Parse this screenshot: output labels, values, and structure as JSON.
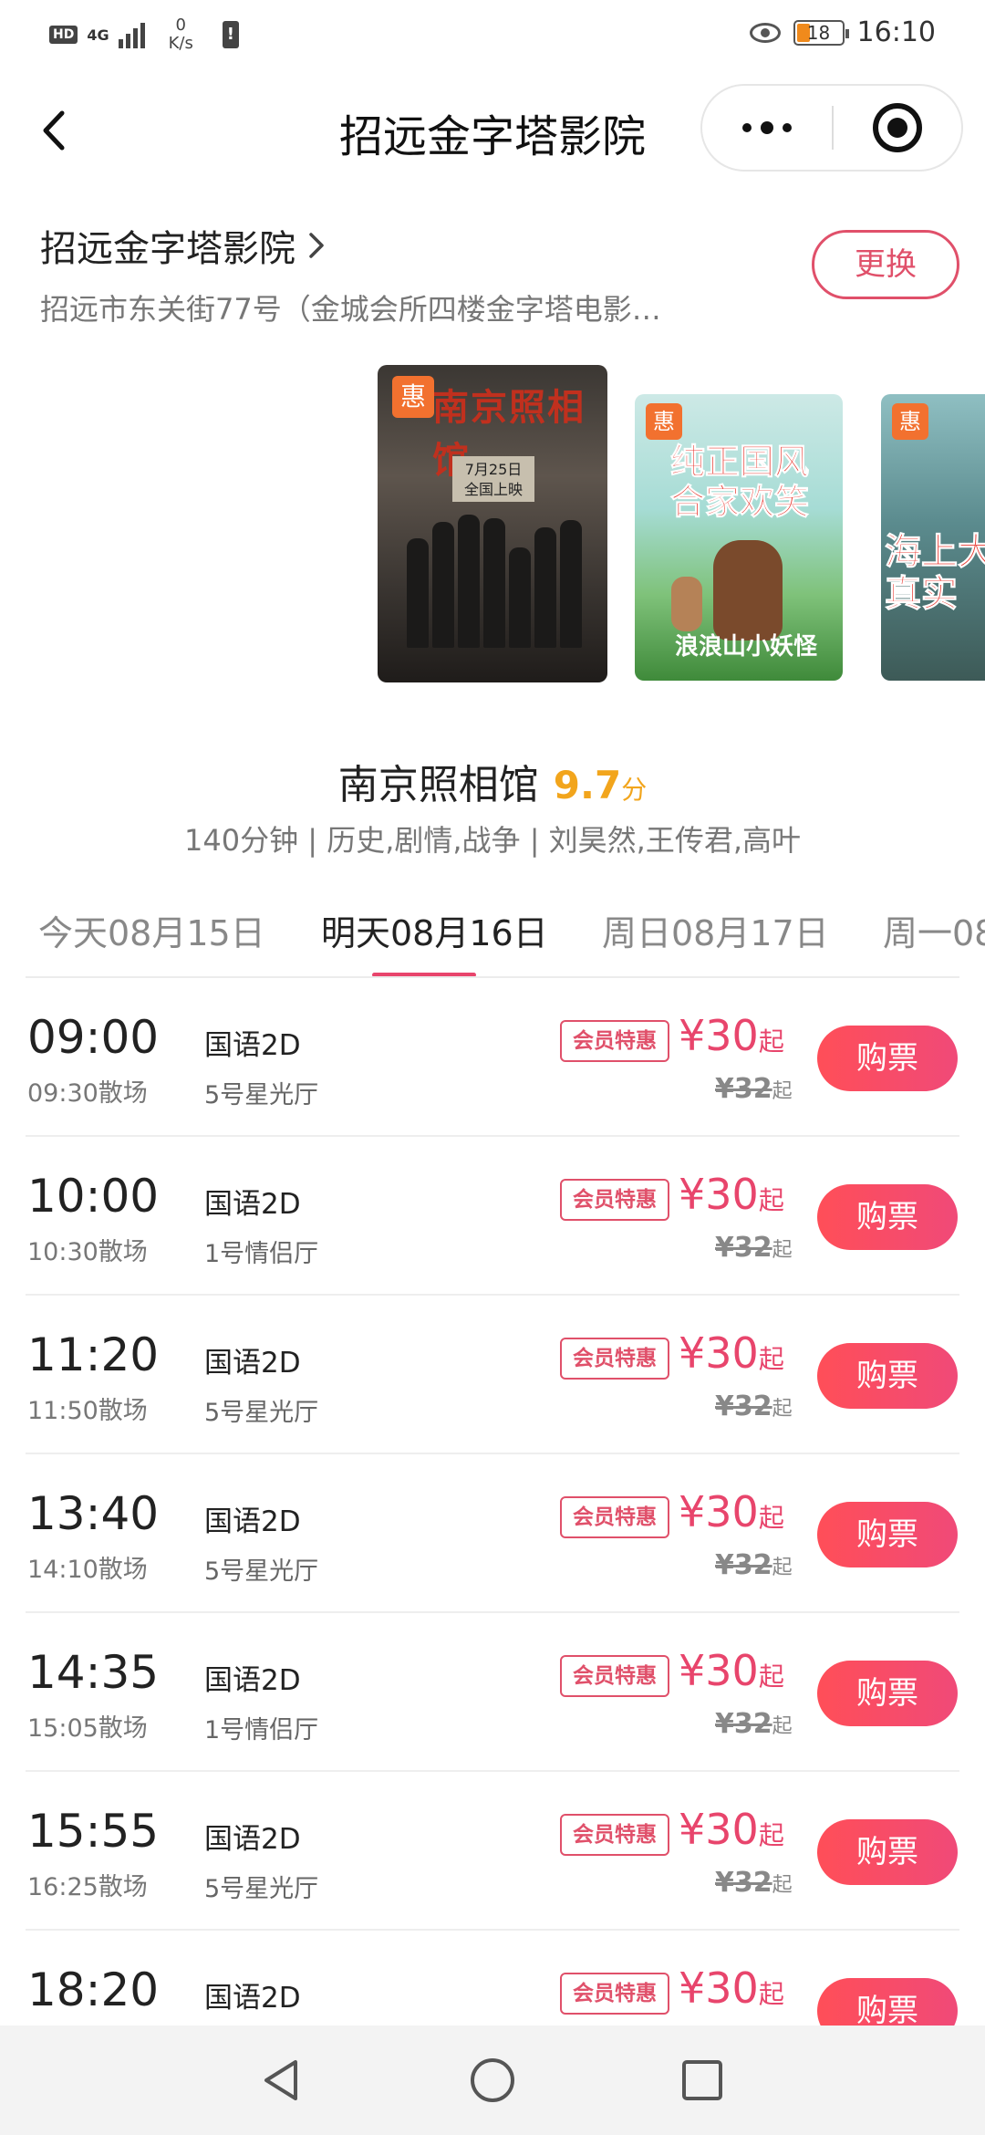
{
  "status_bar": {
    "hd": "HD",
    "network": "4G",
    "speed_value": "0",
    "speed_unit": "K/s",
    "alert": "!",
    "battery": "18",
    "time": "16:10"
  },
  "nav": {
    "title": "招远金字塔影院"
  },
  "cinema": {
    "name": "招远金字塔影院",
    "address": "招远市东关街77号（金城会所四楼金字塔电影…",
    "change_label": "更换"
  },
  "posters": [
    {
      "badge": "惠",
      "title": "南京照相馆",
      "release": "7月25日\n全国上映"
    },
    {
      "badge": "惠",
      "title": "纯正国风\n合家欢笑",
      "script": "浪浪山小妖怪"
    },
    {
      "badge": "惠",
      "title": "海上大\n真实"
    }
  ],
  "movie": {
    "title": "南京照相馆",
    "score": "9.7",
    "score_unit": "分",
    "meta": "140分钟 | 历史,剧情,战争 | 刘昊然,王传君,高叶"
  },
  "date_tabs": [
    {
      "label": "今天08月15日",
      "active": false
    },
    {
      "label": "明天08月16日",
      "active": true
    },
    {
      "label": "周日08月17日",
      "active": false
    },
    {
      "label": "周一08",
      "active": false
    }
  ],
  "showtimes": [
    {
      "start": "09:00",
      "end": "09:30散场",
      "lang": "国语2D",
      "hall": "5号星光厅",
      "badge": "会员特惠",
      "price": "¥30",
      "price_suffix": "起",
      "orig": "¥32",
      "orig_suffix": "起",
      "buy": "购票"
    },
    {
      "start": "10:00",
      "end": "10:30散场",
      "lang": "国语2D",
      "hall": "1号情侣厅",
      "badge": "会员特惠",
      "price": "¥30",
      "price_suffix": "起",
      "orig": "¥32",
      "orig_suffix": "起",
      "buy": "购票"
    },
    {
      "start": "11:20",
      "end": "11:50散场",
      "lang": "国语2D",
      "hall": "5号星光厅",
      "badge": "会员特惠",
      "price": "¥30",
      "price_suffix": "起",
      "orig": "¥32",
      "orig_suffix": "起",
      "buy": "购票"
    },
    {
      "start": "13:40",
      "end": "14:10散场",
      "lang": "国语2D",
      "hall": "5号星光厅",
      "badge": "会员特惠",
      "price": "¥30",
      "price_suffix": "起",
      "orig": "¥32",
      "orig_suffix": "起",
      "buy": "购票"
    },
    {
      "start": "14:35",
      "end": "15:05散场",
      "lang": "国语2D",
      "hall": "1号情侣厅",
      "badge": "会员特惠",
      "price": "¥30",
      "price_suffix": "起",
      "orig": "¥32",
      "orig_suffix": "起",
      "buy": "购票"
    },
    {
      "start": "15:55",
      "end": "16:25散场",
      "lang": "国语2D",
      "hall": "5号星光厅",
      "badge": "会员特惠",
      "price": "¥30",
      "price_suffix": "起",
      "orig": "¥32",
      "orig_suffix": "起",
      "buy": "购票"
    },
    {
      "start": "18:20",
      "end": "",
      "lang": "国语2D",
      "hall": "",
      "badge": "会员特惠",
      "price": "¥30",
      "price_suffix": "起",
      "orig": "",
      "orig_suffix": "",
      "buy": "购票"
    }
  ],
  "colors": {
    "accent": "#e8456c",
    "score": "#f2a51c",
    "promo_badge": "#f2712f"
  },
  "icons": {
    "back": "chevron-left-icon",
    "more": "more-dots-icon",
    "close": "target-close-icon",
    "cinema_chevron": "chevron-right-icon",
    "sys_back": "triangle-back-icon",
    "sys_home": "circle-home-icon",
    "sys_recent": "square-recent-icon"
  }
}
